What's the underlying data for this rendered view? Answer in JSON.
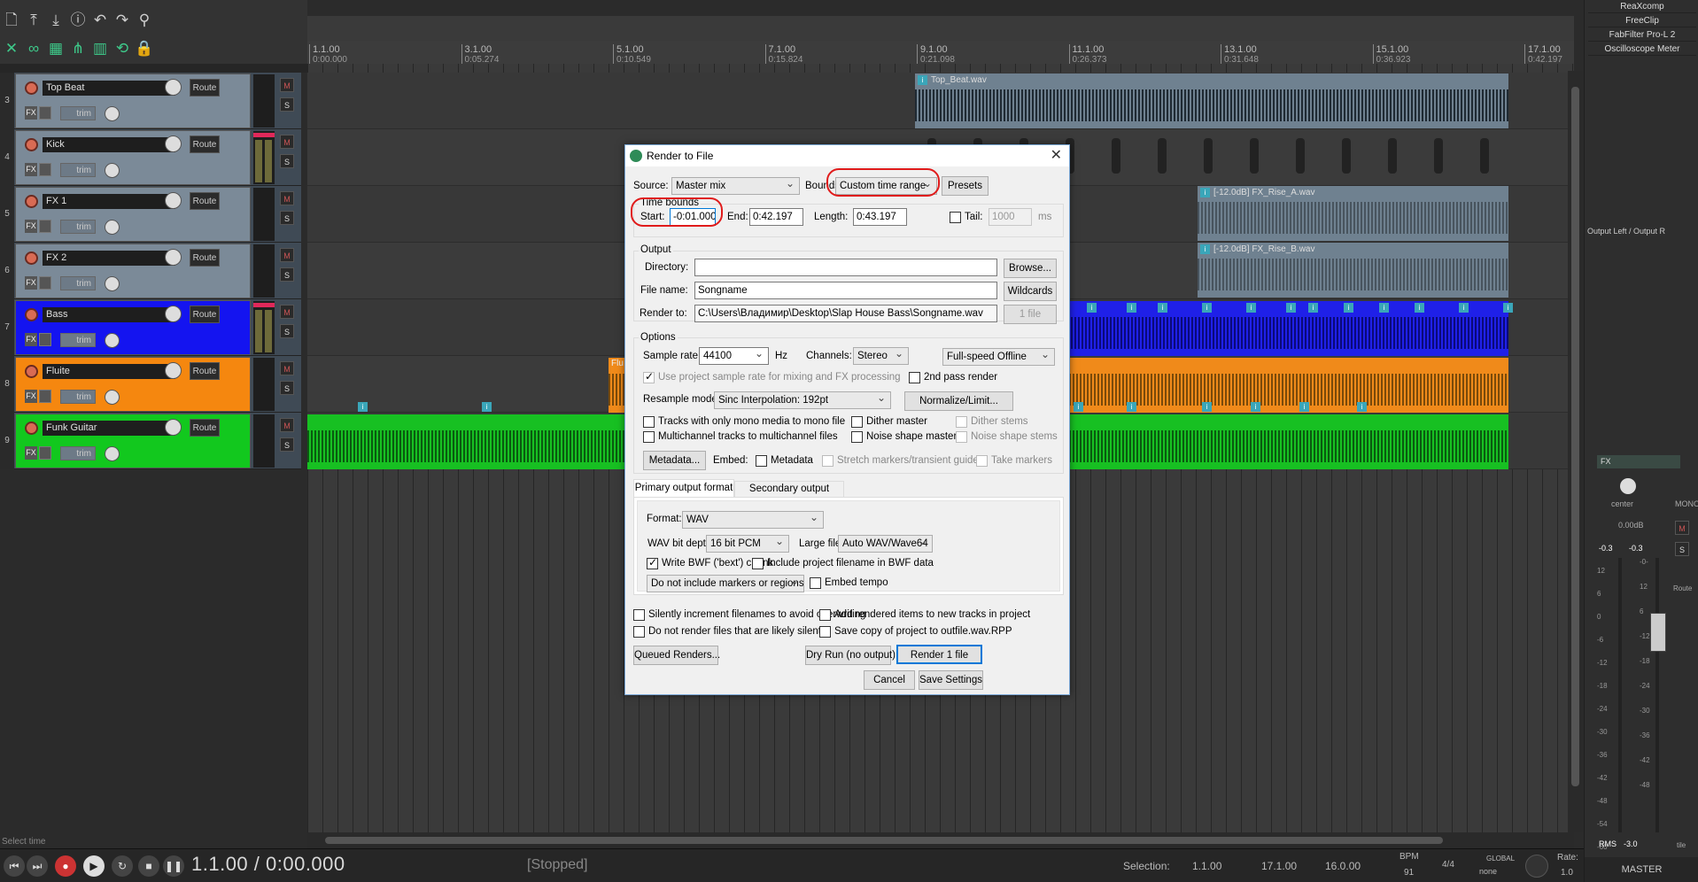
{
  "toolbar": {
    "icons": [
      "new-file-icon",
      "save-down-icon",
      "save-icon",
      "info-icon",
      "undo-icon",
      "redo-icon",
      "metronome-icon",
      "ripple-icon",
      "link-icon",
      "grid-icon",
      "snap-icon",
      "grid2-icon",
      "loop-icon",
      "lock-icon"
    ]
  },
  "ruler": {
    "marks": [
      {
        "bar": "1.1.00",
        "time": "0:00.000"
      },
      {
        "bar": "3.1.00",
        "time": "0:05.274"
      },
      {
        "bar": "5.1.00",
        "time": "0:10.549"
      },
      {
        "bar": "7.1.00",
        "time": "0:15.824"
      },
      {
        "bar": "9.1.00",
        "time": "0:21.098"
      },
      {
        "bar": "11.1.00",
        "time": "0:26.373"
      },
      {
        "bar": "13.1.00",
        "time": "0:31.648"
      },
      {
        "bar": "15.1.00",
        "time": "0:36.923"
      },
      {
        "bar": "17.1.00",
        "time": "0:42.197"
      }
    ]
  },
  "tracks": [
    {
      "num": "3",
      "name": "Top Beat",
      "route": "Route",
      "trim": "trim",
      "color": "#7b8a98",
      "fx": "FX",
      "m": "M",
      "s": "S"
    },
    {
      "num": "4",
      "name": "Kick",
      "route": "Route",
      "trim": "trim",
      "color": "#7b8a98",
      "fx": "FX",
      "m": "M",
      "s": "S"
    },
    {
      "num": "5",
      "name": "FX 1",
      "route": "Route",
      "trim": "trim",
      "color": "#7b8a98",
      "fx": "FX",
      "m": "M",
      "s": "S"
    },
    {
      "num": "6",
      "name": "FX 2",
      "route": "Route",
      "trim": "trim",
      "color": "#7b8a98",
      "fx": "FX",
      "m": "M",
      "s": "S"
    },
    {
      "num": "7",
      "name": "Bass",
      "route": "Route",
      "trim": "trim",
      "color": "#1414f0",
      "fx": "FX",
      "m": "M",
      "s": "S"
    },
    {
      "num": "8",
      "name": "Fluite",
      "route": "Route",
      "trim": "trim",
      "color": "#f5870f",
      "fx": "FX",
      "m": "M",
      "s": "S"
    },
    {
      "num": "9",
      "name": "Funk Guitar",
      "route": "Route",
      "trim": "trim",
      "color": "#12c81e",
      "fx": "FX",
      "m": "M",
      "s": "S"
    }
  ],
  "items": {
    "top_beat": "Top_Beat.wav",
    "rise_a": "[-12.0dB] FX_Rise_A.wav",
    "rise_b": "[-12.0dB] FX_Rise_B.wav",
    "flute_label": "Flu",
    "badge": "i"
  },
  "right_panel": {
    "fx": [
      "ReaXcomp",
      "FreeClip",
      "FabFilter Pro-L 2",
      "Oscilloscope Meter"
    ],
    "output_label": "Output Left / Output R",
    "fx_btn": "FX",
    "pan": "center",
    "mono": "MONO",
    "m": "M",
    "s": "S",
    "route": "Route",
    "db": "0.00dB",
    "peak_l": "-0.3",
    "peak_r": "-0.3",
    "rms_label": "RMS",
    "rms_val": "-3.0",
    "master": "MASTER",
    "scale_l": [
      "12",
      "6",
      "0",
      "-6",
      "-12",
      "-18",
      "-24",
      "-30",
      "-36",
      "-42",
      "-48",
      "-54",
      "-60"
    ],
    "scale_r": [
      "-0-",
      "12",
      "6",
      "-12",
      "-18",
      "-24",
      "-30",
      "-36",
      "-42",
      "-48"
    ],
    "tile": "tile"
  },
  "transport": {
    "time": "1.1.00 / 0:00.000",
    "status": "[Stopped]",
    "select_time": "Select time",
    "selection_label": "Selection:",
    "sel_start": "1.1.00",
    "sel_end": "17.1.00",
    "sel_len": "16.0.00",
    "bpm_label": "BPM",
    "bpm": "91",
    "sig": "4/4",
    "global": "GLOBAL",
    "none": "none",
    "rate_label": "Rate:",
    "rate": "1.0"
  },
  "dialog": {
    "title": "Render to File",
    "close": "✕",
    "source_label": "Source:",
    "source": "Master mix",
    "bounds_label": "Bounds:",
    "bounds": "Custom time range",
    "presets": "Presets",
    "time_bounds": "Time bounds",
    "start_label": "Start:",
    "start": "-0:01.000",
    "end_label": "End:",
    "end": "0:42.197",
    "length_label": "Length:",
    "length": "0:43.197",
    "tail_label": "Tail:",
    "tail": "1000",
    "ms": "ms",
    "output": "Output",
    "directory_label": "Directory:",
    "directory": "",
    "browse": "Browse...",
    "filename_label": "File name:",
    "filename": "Songname",
    "wildcards": "Wildcards",
    "renderto_label": "Render to:",
    "renderto": "C:\\Users\\Владимир\\Desktop\\Slap House Bass\\Songname.wav",
    "files": "1 file",
    "options": "Options",
    "samplerate_label": "Sample rate:",
    "samplerate": "44100",
    "hz": "Hz",
    "channels_label": "Channels:",
    "channels": "Stereo",
    "speed": "Full-speed Offline",
    "use_project_rate": "Use project sample rate for mixing and FX processing",
    "second_pass": "2nd pass render",
    "resample_label": "Resample mode:",
    "resample": "Sinc Interpolation: 192pt",
    "normalize": "Normalize/Limit...",
    "mono_tracks": "Tracks with only mono media to mono file",
    "dither_master": "Dither master",
    "dither_stems": "Dither stems",
    "multichannel": "Multichannel tracks to multichannel files",
    "noise_master": "Noise shape master",
    "noise_stems": "Noise shape stems",
    "metadata_btn": "Metadata...",
    "embed_label": "Embed:",
    "metadata": "Metadata",
    "stretch": "Stretch markers/transient guides",
    "take_markers": "Take markers",
    "tab_primary": "Primary output format",
    "tab_secondary": "Secondary output format",
    "format_label": "Format:",
    "format": "WAV",
    "bitdepth_label": "WAV bit depth:",
    "bitdepth": "16 bit PCM",
    "largefiles_label": "Large files:",
    "largefiles": "Auto WAV/Wave64",
    "bwf": "Write BWF ('bext') chunk",
    "include_project": "Include project filename in BWF data",
    "markers": "Do not include markers or regions",
    "embed_tempo": "Embed tempo",
    "silently": "Silently increment filenames to avoid overwriting",
    "add_rendered": "Add rendered items to new tracks in project",
    "no_silent": "Do not render files that are likely silent",
    "save_copy": "Save copy of project to outfile.wav.RPP",
    "queued": "Queued Renders...",
    "dryrun": "Dry Run (no output)",
    "render": "Render 1 file",
    "cancel": "Cancel",
    "save_settings": "Save Settings"
  }
}
